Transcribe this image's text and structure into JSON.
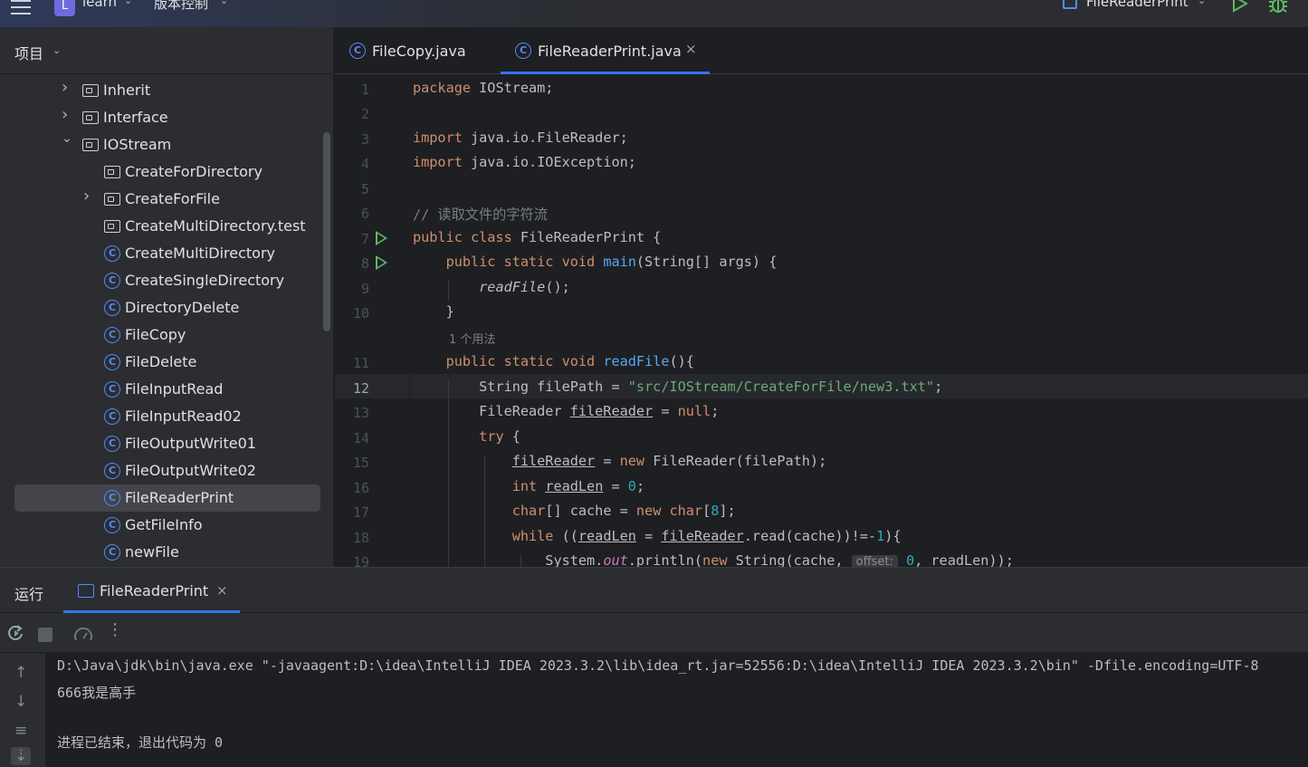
{
  "titlebar": {
    "project_badge": "L",
    "project_name": "learn",
    "vcs_label": "版本控制",
    "run_config": "FileReaderPrint",
    "run_icon": "play-icon",
    "debug_icon": "bug-icon"
  },
  "project_panel": {
    "title": "项目",
    "tree": [
      {
        "label": "Inherit",
        "type": "folder",
        "expand": "collapsed"
      },
      {
        "label": "Interface",
        "type": "folder",
        "expand": "collapsed"
      },
      {
        "label": "IOStream",
        "type": "folder",
        "expand": "expanded"
      },
      {
        "label": "CreateForDirectory",
        "type": "folder",
        "expand": "none"
      },
      {
        "label": "CreateForFile",
        "type": "folder",
        "expand": "collapsed"
      },
      {
        "label": "CreateMultiDirectory.test",
        "type": "folder",
        "expand": "none"
      },
      {
        "label": "CreateMultiDirectory",
        "type": "class",
        "expand": "none"
      },
      {
        "label": "CreateSingleDirectory",
        "type": "class",
        "expand": "none"
      },
      {
        "label": "DirectoryDelete",
        "type": "class",
        "expand": "none"
      },
      {
        "label": "FileCopy",
        "type": "class",
        "expand": "none"
      },
      {
        "label": "FileDelete",
        "type": "class",
        "expand": "none"
      },
      {
        "label": "FileInputRead",
        "type": "class",
        "expand": "none"
      },
      {
        "label": "FileInputRead02",
        "type": "class",
        "expand": "none"
      },
      {
        "label": "FileOutputWrite01",
        "type": "class",
        "expand": "none"
      },
      {
        "label": "FileOutputWrite02",
        "type": "class",
        "expand": "none"
      },
      {
        "label": "FileReaderPrint",
        "type": "class",
        "expand": "none",
        "selected": true
      },
      {
        "label": "GetFileInfo",
        "type": "class",
        "expand": "none"
      },
      {
        "label": "newFile",
        "type": "class",
        "expand": "none"
      }
    ]
  },
  "editor": {
    "tabs": [
      {
        "label": "FileCopy.java",
        "active": false
      },
      {
        "label": "FileReaderPrint.java",
        "active": true,
        "close": "×"
      }
    ],
    "class_icon_glyph": "C",
    "usage_hint": "1 个用法",
    "param_hint": "offset:",
    "current_line": "12",
    "line_numbers": [
      "1",
      "2",
      "3",
      "4",
      "5",
      "6",
      "7",
      "8",
      "9",
      "10",
      "11",
      "12",
      "13",
      "14",
      "15",
      "16",
      "17",
      "18",
      "19"
    ]
  },
  "run_panel": {
    "title": "运行",
    "tab_label": "FileReaderPrint",
    "tab_close": "×",
    "console": [
      "D:\\Java\\jdk\\bin\\java.exe \"-javaagent:D:\\idea\\IntelliJ IDEA 2023.3.2\\lib\\idea_rt.jar=52556:D:\\idea\\IntelliJ IDEA 2023.3.2\\bin\" -Dfile.encoding=UTF-8",
      "666我是高手",
      "",
      "进程已结束，退出代码为 0"
    ]
  },
  "colors": {
    "accent": "#3574f0",
    "keyword": "#cf8e6d",
    "function": "#56a8f5",
    "string": "#6aab73",
    "number": "#2aacb8",
    "run_green": "#5fb865"
  }
}
